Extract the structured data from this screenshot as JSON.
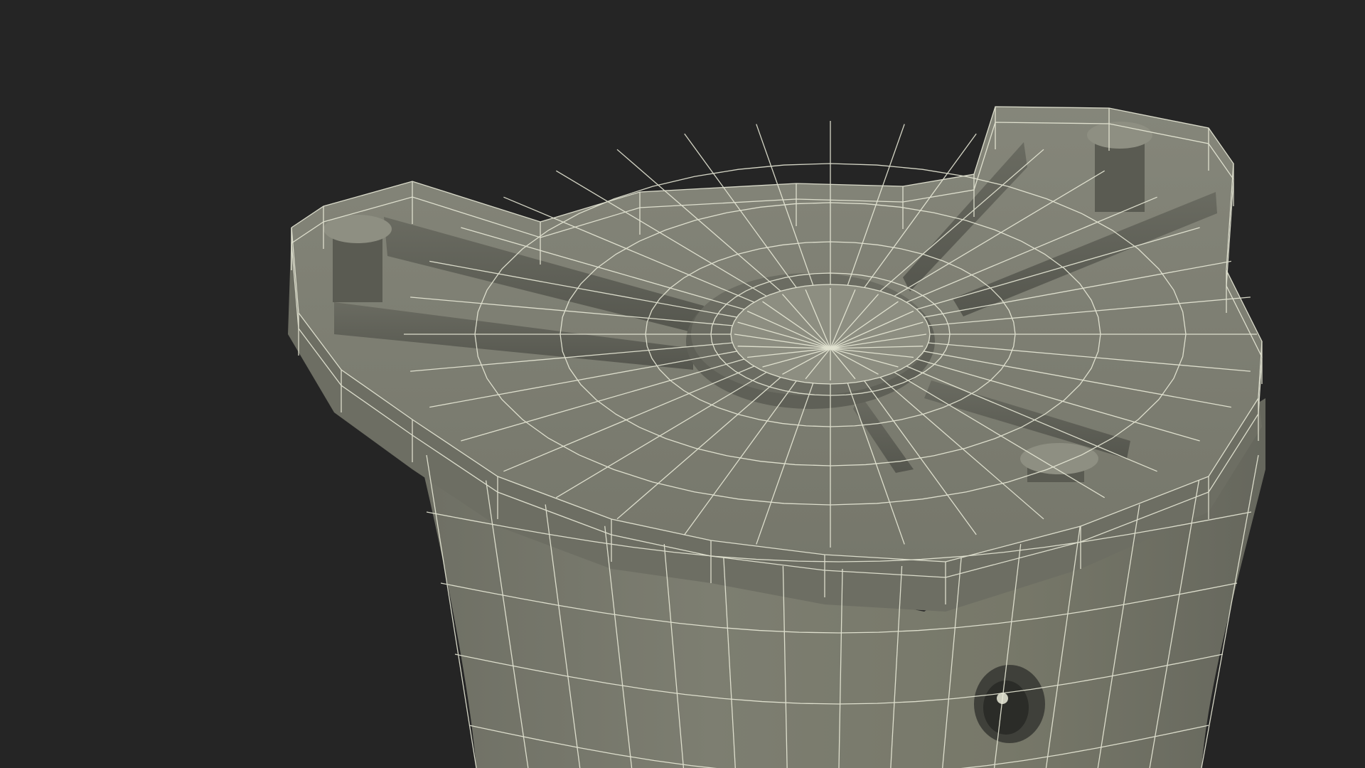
{
  "scene": {
    "subject": "wireframe-3d-model",
    "colors": {
      "background": "#252525",
      "surface_light": "#8a8b7c",
      "surface_mid": "#74756a",
      "surface_dark": "#5b5c54",
      "surface_shadow": "#45463f",
      "wire": "#e9ead8"
    }
  }
}
